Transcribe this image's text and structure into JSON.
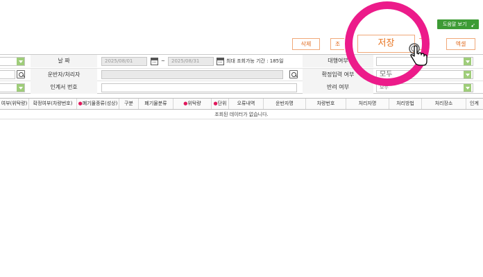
{
  "toolbar": {
    "help_label": "도움말 보기",
    "delete_label": "삭제",
    "partial_label": "조",
    "save_label": "저장",
    "excel_label": "엑셀"
  },
  "filter": {
    "date_label": "날 짜",
    "date_from": "2025/08/01",
    "date_to": "2025/08/31",
    "date_sep": "~",
    "max_range_text": "최대 조회가능 기간 : 185일",
    "proxy_label": "대행여부",
    "carrier_label": "운반자/처리자",
    "confirm_label": "확정입력 여부",
    "confirm_value": "모두",
    "handover_label": "인계서 번호",
    "reject_label": "반려 여부",
    "reject_value": "모두"
  },
  "grid": {
    "columns": [
      {
        "label": "여부(위탁량)",
        "required": false
      },
      {
        "label": "확정여부(차량번호)",
        "required": false
      },
      {
        "label": "폐기물종류(성상)",
        "required": true
      },
      {
        "label": "구분",
        "required": false
      },
      {
        "label": "폐기물분류",
        "required": false
      },
      {
        "label": "위탁량",
        "required": true
      },
      {
        "label": "단위",
        "required": true
      },
      {
        "label": "오류내역",
        "required": false
      },
      {
        "label": "운반자명",
        "required": false
      },
      {
        "label": "차량번호",
        "required": false
      },
      {
        "label": "처리자명",
        "required": false
      },
      {
        "label": "처리방법",
        "required": false
      },
      {
        "label": "처리장소",
        "required": false
      },
      {
        "label": "인계",
        "required": false
      }
    ],
    "empty_message": "조회된 데이터가 없습니다."
  },
  "colors": {
    "highlight_ring": "#ec1b8a",
    "accent_orange": "#e8731f",
    "help_green": "#3d9b35",
    "select_green": "#9fcd7a"
  }
}
